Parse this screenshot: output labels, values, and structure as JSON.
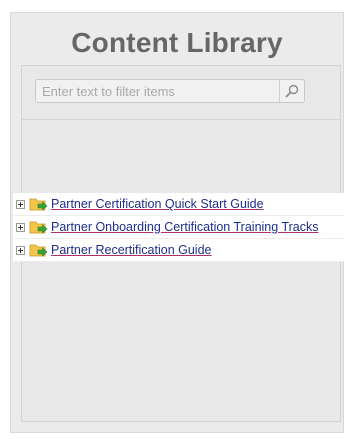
{
  "header": {
    "title": "Content Library"
  },
  "filter": {
    "placeholder": "Enter text to filter items"
  },
  "tree": {
    "items": [
      {
        "label": "Partner Certification Quick Start Guide"
      },
      {
        "label": "Partner Onboarding Certification Training Tracks"
      },
      {
        "label": "Partner Recertification Guide"
      }
    ]
  },
  "colors": {
    "panel_bg": "#ebebeb",
    "title": "#666666",
    "link": "#1f2f8c",
    "link_underline": "#b0306a",
    "folder_fill": "#f3c64b",
    "arrow": "#3aa335"
  },
  "icons": {
    "search": "magnifier-icon",
    "expander": "plus-box-icon",
    "folder": "folder-arrow-icon"
  }
}
